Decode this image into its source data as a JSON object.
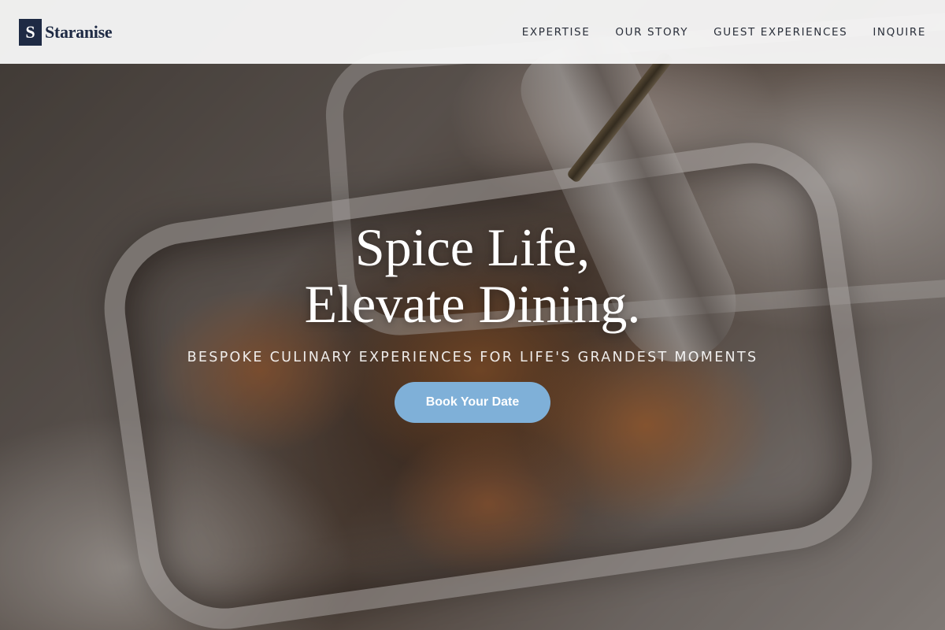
{
  "brand": {
    "mark": "S",
    "name": "Staranise",
    "color": "#1e2a44"
  },
  "nav": {
    "items": [
      {
        "label": "EXPERTISE"
      },
      {
        "label": "OUR STORY"
      },
      {
        "label": "GUEST EXPERIENCES"
      },
      {
        "label": "INQUIRE"
      }
    ]
  },
  "hero": {
    "headline_line1": "Spice Life,",
    "headline_line2": "Elevate Dining.",
    "tagline": "BESPOKE CULINARY EXPERIENCES FOR LIFE'S GRANDEST MOMENTS",
    "cta_label": "Book Your Date",
    "cta_color": "#7fb0d8",
    "background_image": "food-in-chafing-dish-photo"
  }
}
